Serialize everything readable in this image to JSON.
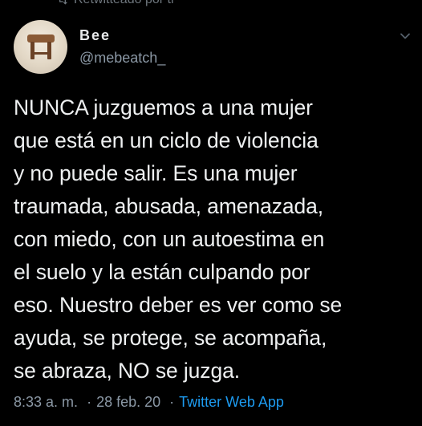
{
  "retweet": {
    "label": "Retwitteado por ti"
  },
  "tweet": {
    "author": {
      "display_name": "Bee",
      "handle": "@mebeatch_"
    },
    "text": "NUNCA juzguemos a una mujer\nque está en un ciclo de violencia\ny no puede salir. Es una mujer\ntraumada, abusada, amenazada,\ncon miedo, con un autoestima en\nel suelo y la están culpando por\neso. Nuestro deber es ver como se\nayuda, se protege, se acompaña,\nse abraza, NO se juzga.",
    "time": "8:33 a. m.",
    "separator": "·",
    "date": "28 feb. 20",
    "source": "Twitter Web App"
  },
  "colors": {
    "background": "#000000",
    "text": "#e7e9ea",
    "secondary": "#8b98a5",
    "link": "#1d9bf0"
  },
  "icons": {
    "retweet": "retweet-icon",
    "more": "chevron-down-icon"
  }
}
